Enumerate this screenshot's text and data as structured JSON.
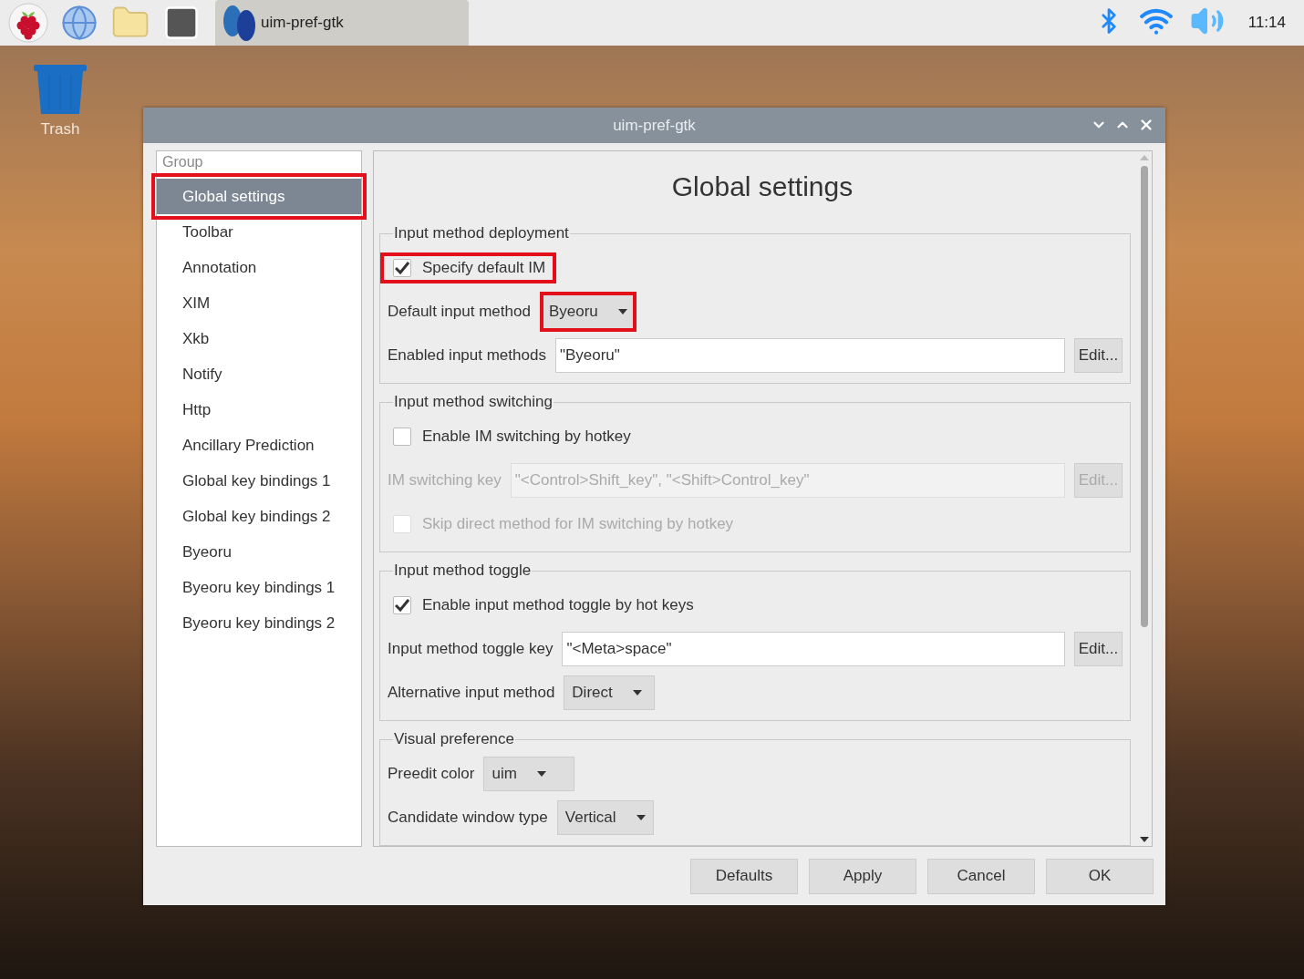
{
  "taskbar": {
    "window_button": {
      "title": "uim-pref-gtk",
      "selected": true
    },
    "clock": "11:14"
  },
  "desktop_icons": [
    {
      "label": "Trash"
    }
  ],
  "dialog": {
    "title": "uim-pref-gtk",
    "sidebar": {
      "header": "Group",
      "items": [
        {
          "label": "Global settings",
          "selected": true,
          "highlighted": true
        },
        {
          "label": "Toolbar",
          "selected": false,
          "highlighted": false
        },
        {
          "label": "Annotation",
          "selected": false,
          "highlighted": false
        },
        {
          "label": "XIM",
          "selected": false,
          "highlighted": false
        },
        {
          "label": "Xkb",
          "selected": false,
          "highlighted": false
        },
        {
          "label": "Notify",
          "selected": false,
          "highlighted": false
        },
        {
          "label": "Http",
          "selected": false,
          "highlighted": false
        },
        {
          "label": "Ancillary Prediction",
          "selected": false,
          "highlighted": false
        },
        {
          "label": "Global key bindings 1",
          "selected": false,
          "highlighted": false
        },
        {
          "label": "Global key bindings 2",
          "selected": false,
          "highlighted": false
        },
        {
          "label": "Byeoru",
          "selected": false,
          "highlighted": false
        },
        {
          "label": "Byeoru key bindings 1",
          "selected": false,
          "highlighted": false
        },
        {
          "label": "Byeoru key bindings 2",
          "selected": false,
          "highlighted": false
        }
      ]
    },
    "panel": {
      "heading": "Global settings",
      "sections": [
        {
          "title": "Input method deployment",
          "rows": [
            {
              "kind": "checkbox",
              "label": "Specify default IM",
              "checked": true,
              "disabled": false,
              "highlighted": true
            },
            {
              "kind": "combo",
              "label": "Default input method",
              "value": "Byeoru",
              "highlighted": true
            },
            {
              "kind": "entry",
              "label": "Enabled input methods",
              "value": "\"Byeoru\"",
              "button": "Edit...",
              "disabled": false
            }
          ]
        },
        {
          "title": "Input method switching",
          "rows": [
            {
              "kind": "checkbox",
              "label": "Enable IM switching by hotkey",
              "checked": false,
              "disabled": false,
              "highlighted": false
            },
            {
              "kind": "entry",
              "label": "IM switching key",
              "value": "\"<Control>Shift_key\", \"<Shift>Control_key\"",
              "button": "Edit...",
              "disabled": true
            },
            {
              "kind": "checkbox",
              "label": "Skip direct method for IM switching by hotkey",
              "checked": false,
              "disabled": true,
              "highlighted": false
            }
          ]
        },
        {
          "title": "Input method toggle",
          "rows": [
            {
              "kind": "checkbox",
              "label": "Enable input method toggle by hot keys",
              "checked": true,
              "disabled": false,
              "highlighted": false
            },
            {
              "kind": "entry",
              "label": "Input method toggle key",
              "value": "\"<Meta>space\"",
              "button": "Edit...",
              "disabled": false
            },
            {
              "kind": "combo",
              "label": "Alternative input method",
              "value": "Direct",
              "highlighted": false
            }
          ]
        },
        {
          "title": "Visual preference",
          "rows": [
            {
              "kind": "combo",
              "label": "Preedit color",
              "value": "uim",
              "highlighted": false
            },
            {
              "kind": "combo",
              "label": "Candidate window type",
              "value": "Vertical",
              "highlighted": false
            }
          ]
        }
      ]
    },
    "buttons": [
      "Defaults",
      "Apply",
      "Cancel",
      "OK"
    ]
  }
}
